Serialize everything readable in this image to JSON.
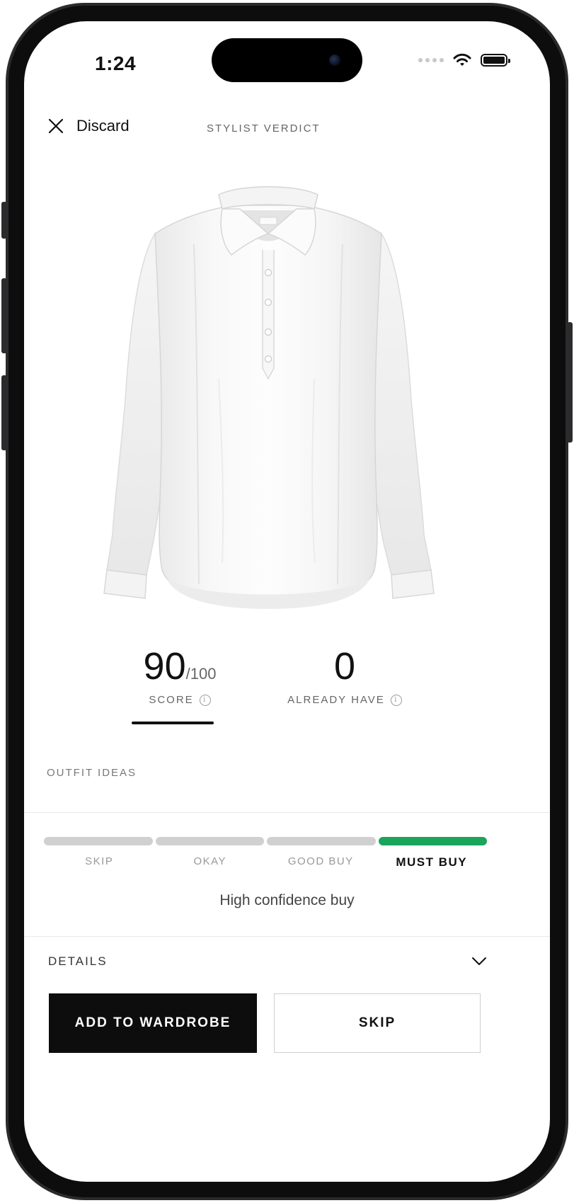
{
  "status_bar": {
    "time": "1:24"
  },
  "header": {
    "discard_label": "Discard",
    "title": "STYLIST VERDICT"
  },
  "scores": {
    "score_value": "90",
    "score_max": "/100",
    "score_label": "SCORE",
    "already_have_value": "0",
    "already_have_label": "ALREADY HAVE"
  },
  "outfit_ideas_label": "OUTFIT IDEAS",
  "verdict_meter": {
    "levels": [
      "SKIP",
      "OKAY",
      "GOOD BUY",
      "MUST BUY"
    ],
    "active_level": "MUST BUY",
    "active_color": "#1aa55a",
    "confidence_text": "High confidence buy"
  },
  "details_label": "DETAILS",
  "actions": {
    "add_label": "ADD TO WARDROBE",
    "skip_label": "SKIP"
  }
}
